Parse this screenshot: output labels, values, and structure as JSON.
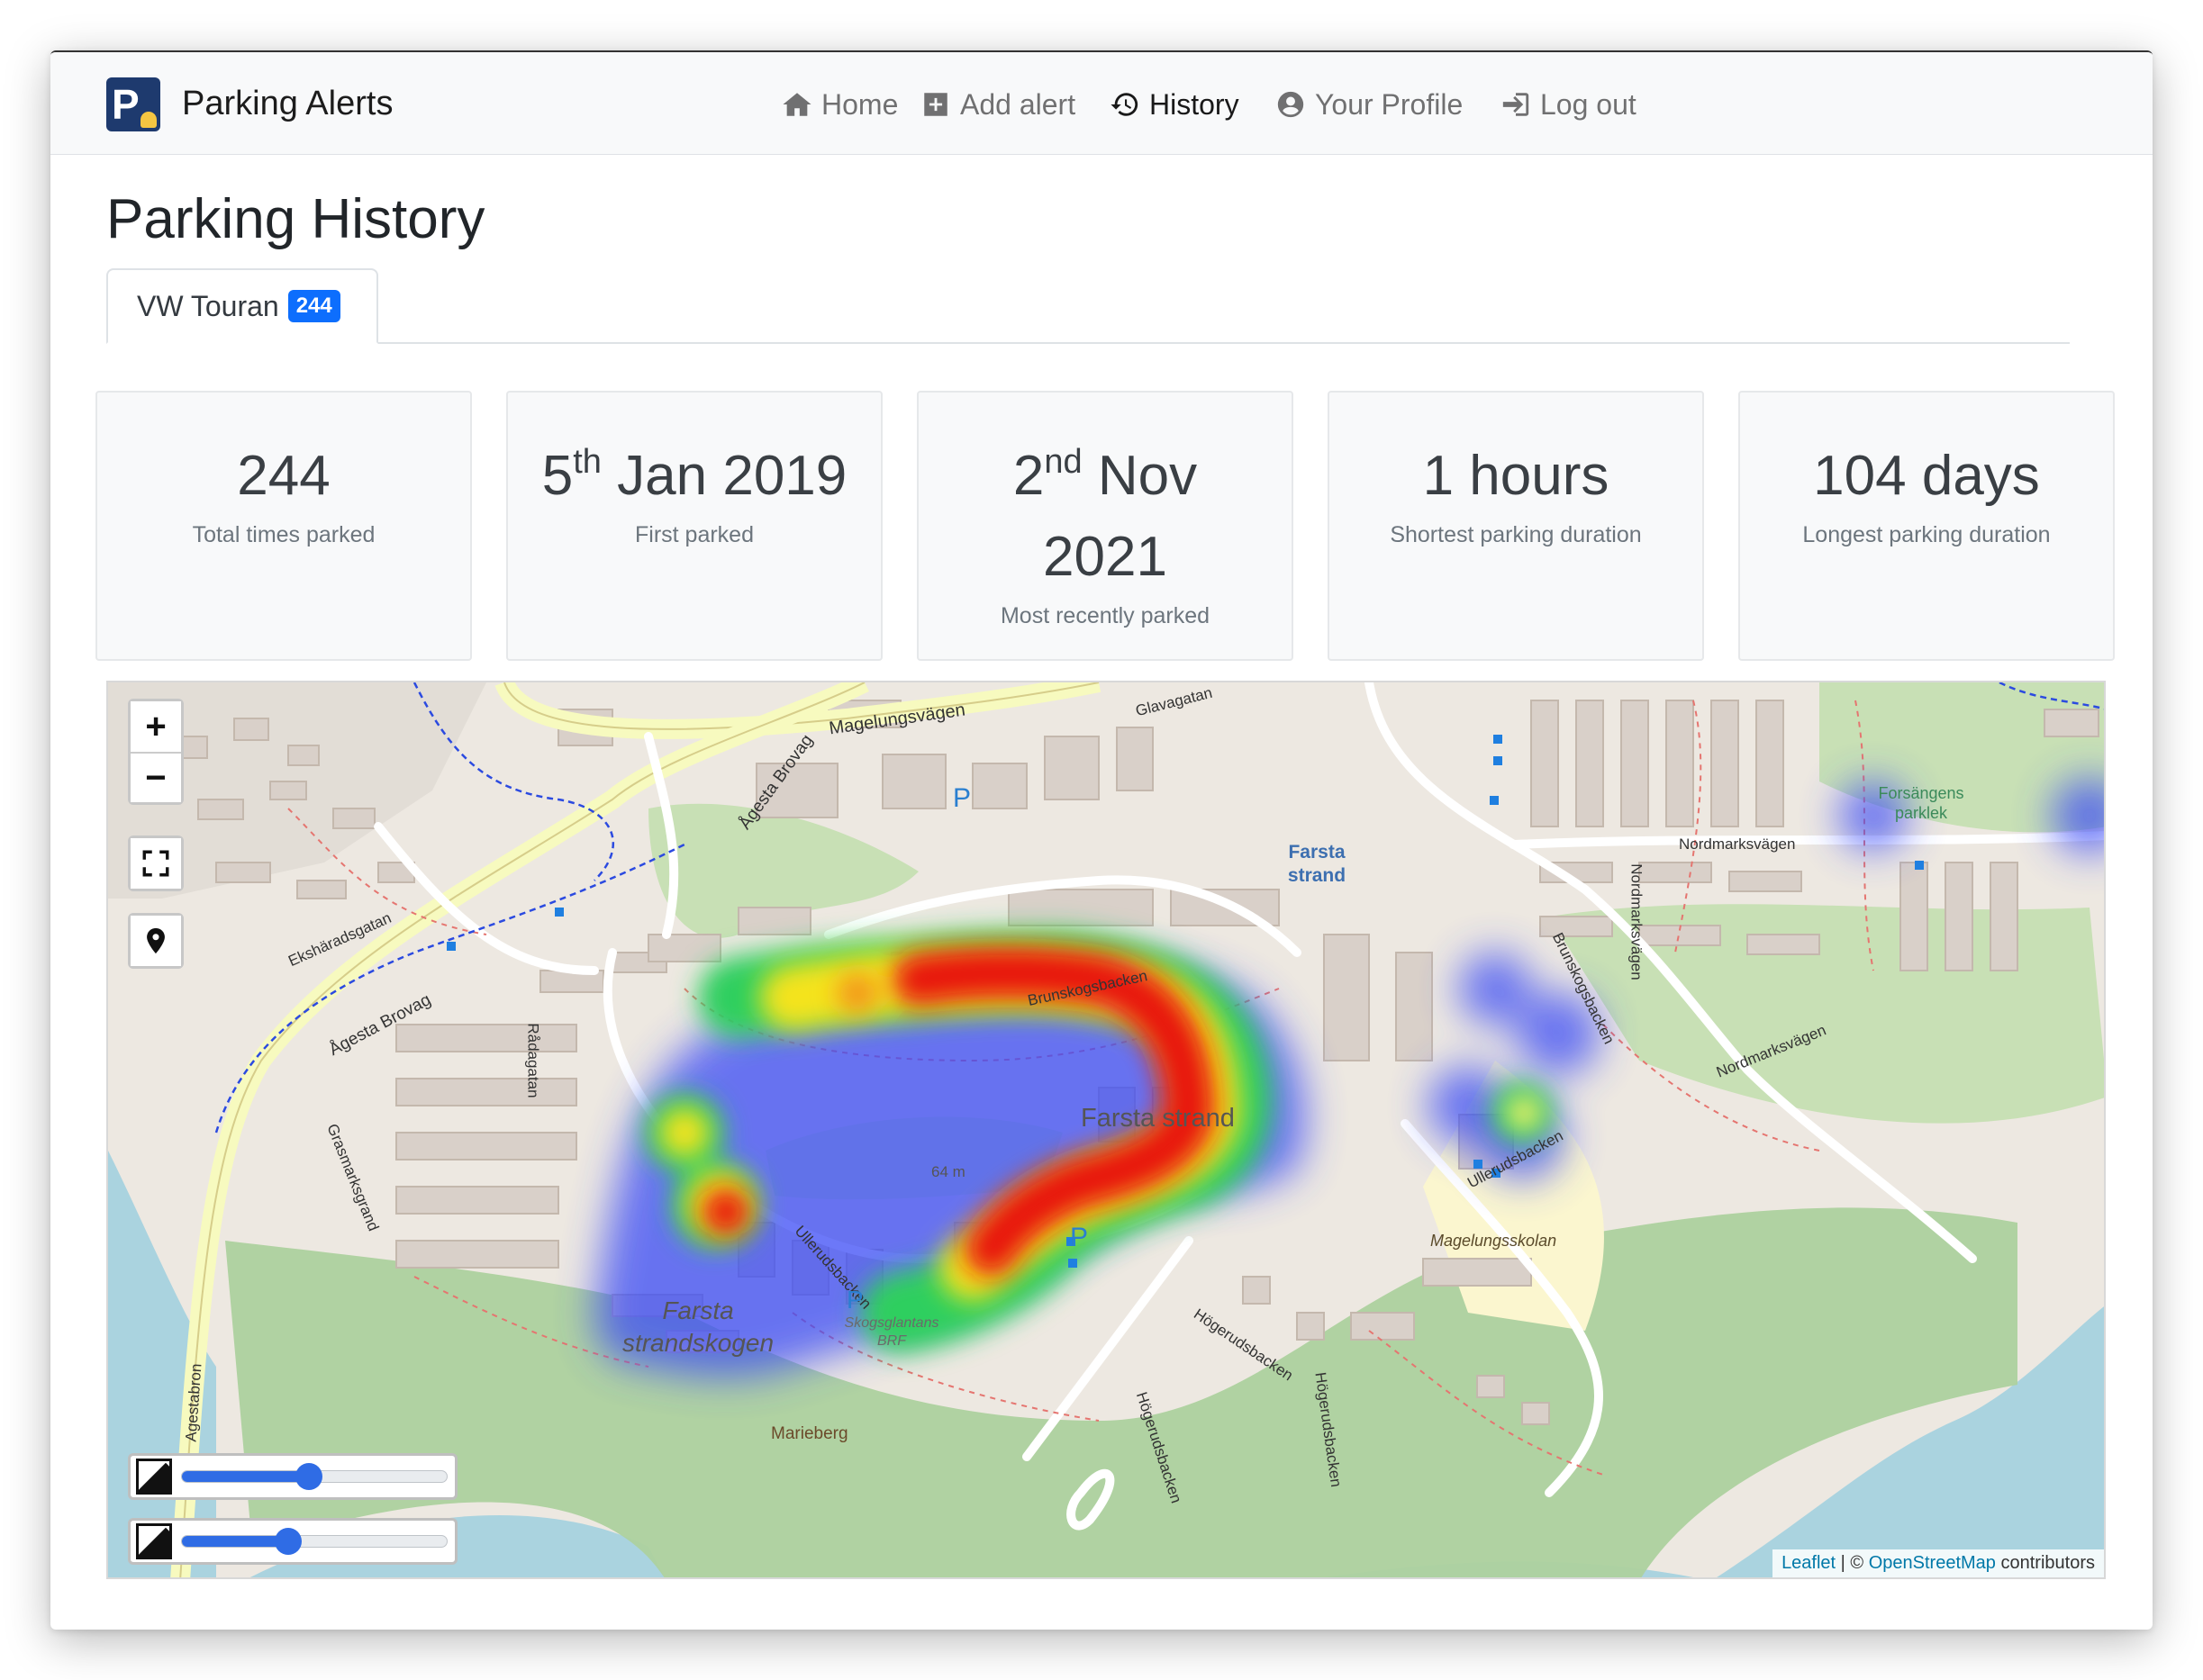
{
  "app": {
    "brand": "Parking Alerts",
    "logo_letter": "P"
  },
  "nav": {
    "items": [
      {
        "label": "Home",
        "icon": "home-icon"
      },
      {
        "label": "Add alert",
        "icon": "plus-square-icon"
      },
      {
        "label": "History",
        "icon": "history-icon",
        "active": true
      },
      {
        "label": "Your Profile",
        "icon": "user-circle-icon"
      },
      {
        "label": "Log out",
        "icon": "sign-out-icon"
      }
    ]
  },
  "page": {
    "title": "Parking History"
  },
  "tabs": [
    {
      "label": "VW Touran",
      "badge": "244"
    }
  ],
  "stats": [
    {
      "value": "244",
      "label": "Total times parked"
    },
    {
      "value_pre": "5",
      "value_sup": "th",
      "value_post": " Jan 2019",
      "label": "First parked"
    },
    {
      "value_pre": "2",
      "value_sup": "nd",
      "value_post": " Nov 2021",
      "label": "Most recently parked"
    },
    {
      "value": "1 hours",
      "label": "Shortest parking duration"
    },
    {
      "value": "104 days",
      "label": "Longest parking duration"
    }
  ],
  "map": {
    "controls": {
      "zoom_in": "+",
      "zoom_out": "−",
      "fullscreen_icon": "fullscreen-icon",
      "locate_icon": "map-pin-icon"
    },
    "sliders": [
      {
        "name": "opacity",
        "value": 0.48
      },
      {
        "name": "radius",
        "value": 0.4
      }
    ],
    "labels": {
      "farsta_strand_area": "Farsta strand",
      "farsta_strand_station": "Farsta strand",
      "farsta_strandskogen": "Farsta strandskogen",
      "magelungsvagen": "Magelungsvägen",
      "agesta_brovag_1": "Ågesta Brovag",
      "agesta_brovag_2": "Ågesta Brovag",
      "glavagatan": "Glavagatan",
      "eksharadsgatan": "Ekshäradsgatan",
      "radagatan": "Rådagatan",
      "grasmarksgrand": "Grasmarksgrand",
      "agestabron": "Agestabron",
      "nordmarksvagen_1": "Nordmarksvägen",
      "nordmarksvagen_2": "Nordmarksvägen",
      "nordmarksvagen_vert": "Nordmarksvägen",
      "brunskogsbacken": "Brunskogsbacken",
      "brunskogsbacken_2": "Brunskogsbacken",
      "ullerudsbacken": "Ullerudsbacken",
      "ullerudsbacken_2": "Ullerudsbacken",
      "magelungsskolan": "Magelungsskolan",
      "hogerudsbacken_1": "Högerudsbacken",
      "hogerudsbacken_2": "Högerudsbacken",
      "hogerudsbacken_3": "Högerudsbacken",
      "skogsglantans_brf": "Skogsglantans BRF",
      "marieberg": "Marieberg",
      "forsangens_parklek": "Forsängens parklek",
      "elevation": "64 m",
      "parking": "P"
    },
    "attribution": {
      "leaflet": "Leaflet",
      "sep": " | © ",
      "osm": "OpenStreetMap",
      "suffix": " contributors"
    }
  },
  "colors": {
    "accent": "#0d6efd",
    "water": "#aad3df",
    "park": "#add19e",
    "land": "#ede8e1",
    "heat_hot": "#e8160c",
    "heat_warm": "#f4e31a",
    "heat_mid": "#2ecf5e",
    "heat_cool": "#3b4cf6"
  }
}
